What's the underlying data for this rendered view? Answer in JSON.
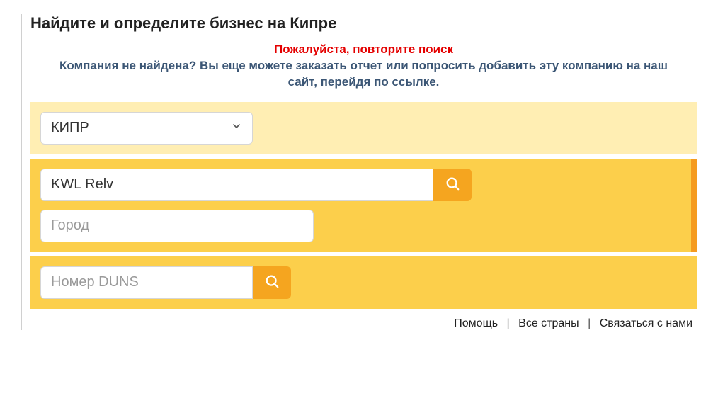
{
  "title": "Найдите и определите бизнес на Кипре",
  "messages": {
    "error": "Пожалуйста, повторите поиск",
    "not_found": "Компания не найдена? Вы еще можете заказать отчет или попросить добавить эту компанию на наш сайт, перейдя по ссылке."
  },
  "country": {
    "selected": "КИПР"
  },
  "search": {
    "company_value": "KWL Relv",
    "city_placeholder": "Город"
  },
  "duns": {
    "placeholder": "Номер DUNS"
  },
  "footer": {
    "help": "Помощь",
    "all_countries": "Все страны",
    "contact": "Связаться с нами"
  }
}
